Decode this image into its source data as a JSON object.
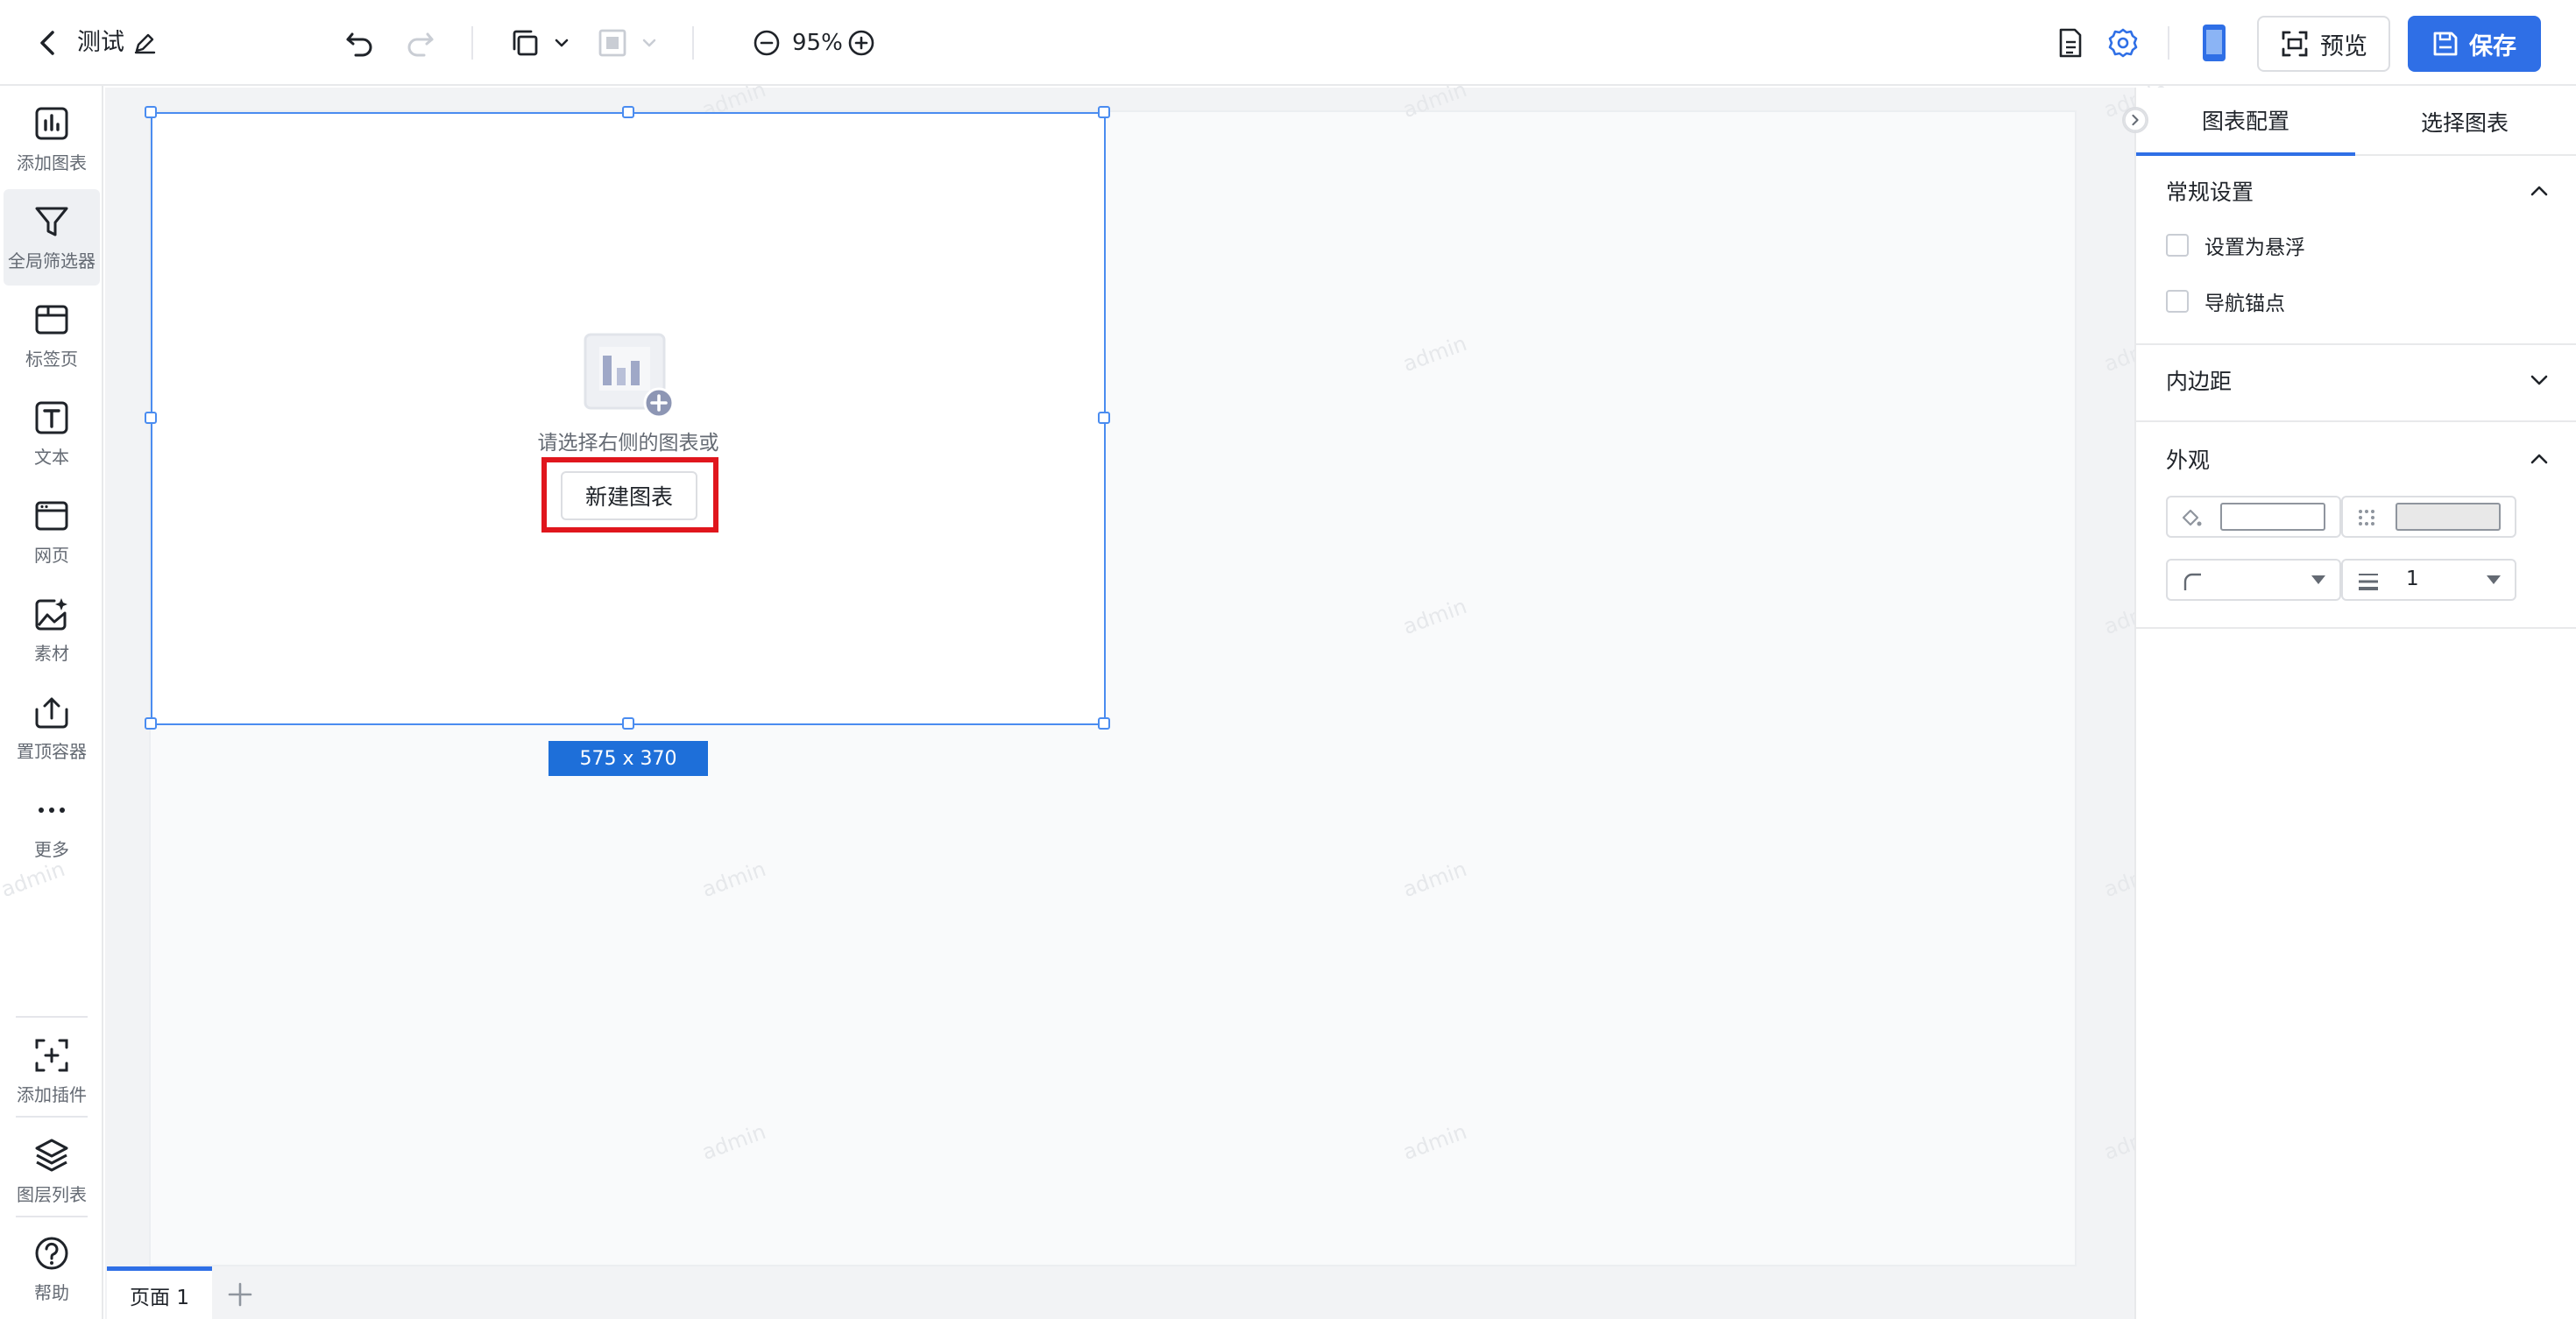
{
  "header": {
    "title": "测试",
    "zoom": "95%",
    "preview_label": "预览",
    "save_label": "保存"
  },
  "sidebar": {
    "items": [
      {
        "label": "添加图表",
        "icon": "chart-icon"
      },
      {
        "label": "全局筛选器",
        "icon": "filter-icon"
      },
      {
        "label": "标签页",
        "icon": "tab-icon"
      },
      {
        "label": "文本",
        "icon": "text-icon"
      },
      {
        "label": "网页",
        "icon": "webpage-icon"
      },
      {
        "label": "素材",
        "icon": "material-icon"
      },
      {
        "label": "置顶容器",
        "icon": "pin-top-icon"
      },
      {
        "label": "更多",
        "icon": "more-icon"
      }
    ],
    "bottom": [
      {
        "label": "添加插件",
        "icon": "plugin-icon"
      },
      {
        "label": "图层列表",
        "icon": "layers-icon"
      },
      {
        "label": "帮助",
        "icon": "help-icon"
      }
    ]
  },
  "canvas": {
    "watermark": "admin",
    "empty_hint": "请选择右侧的图表或",
    "new_chart_label": "新建图表",
    "size_label": "575 x 370"
  },
  "pages": {
    "tabs": [
      "页面 1"
    ]
  },
  "panel": {
    "tabs": [
      "图表配置",
      "选择图表"
    ],
    "general": {
      "title": "常规设置",
      "options": [
        "设置为悬浮",
        "导航锚点"
      ]
    },
    "padding": {
      "title": "内边距"
    },
    "appearance": {
      "title": "外观",
      "line_width": "1",
      "fill_color": "#ffffff",
      "border_color": "#e8e8e8"
    }
  },
  "colors": {
    "accent": "#2f6fe6",
    "selection": "#4a8cf0",
    "highlight": "#e0161d"
  }
}
